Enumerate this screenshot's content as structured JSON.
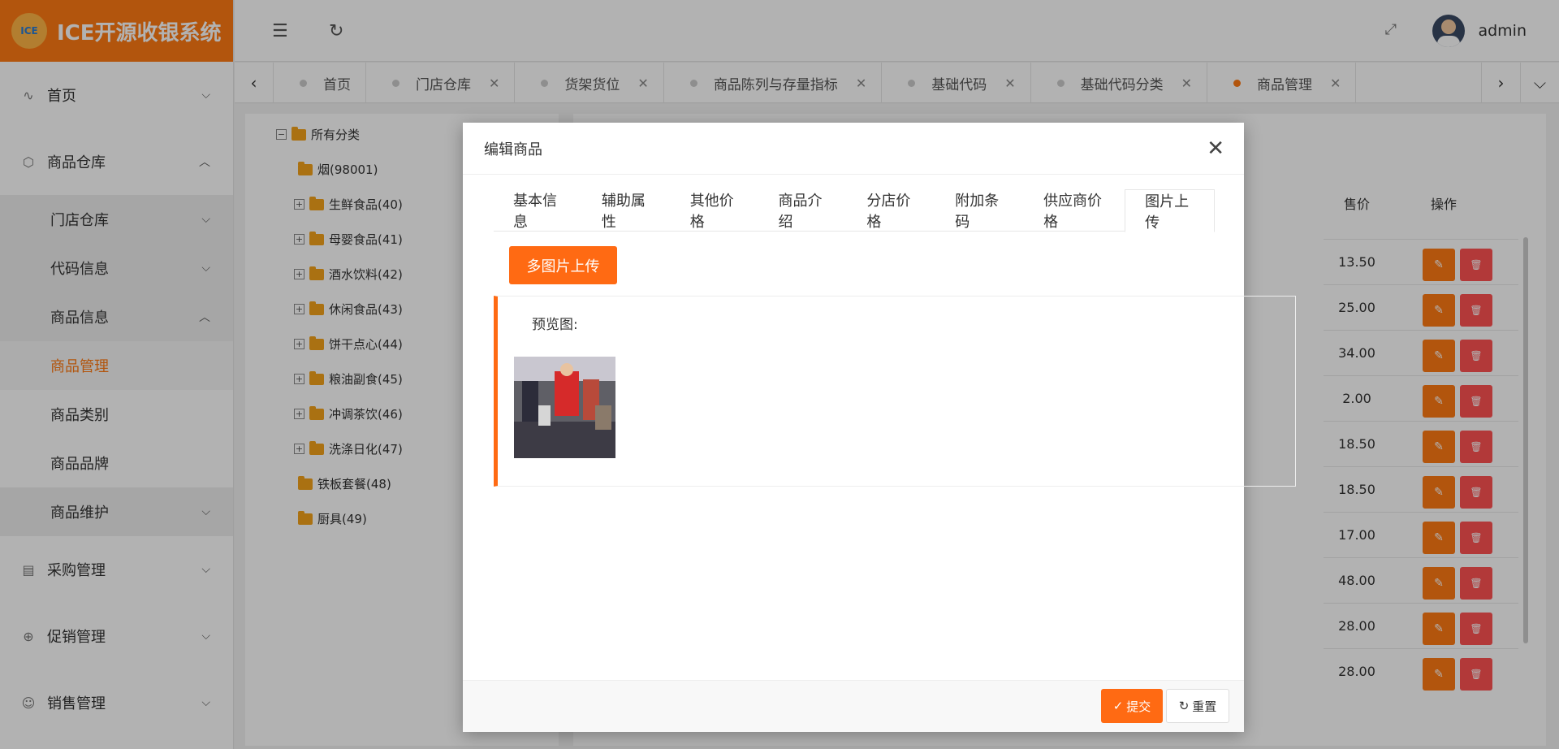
{
  "app": {
    "title": "ICE开源收银系统",
    "logo_text": "ICE"
  },
  "sidebar": {
    "items": [
      {
        "label": "首页",
        "icon": "pulse-icon"
      },
      {
        "label": "商品仓库",
        "icon": "cube-icon"
      },
      {
        "label": "采购管理",
        "icon": "doc-icon"
      },
      {
        "label": "促销管理",
        "icon": "download-circle-icon"
      },
      {
        "label": "销售管理",
        "icon": "users-icon"
      }
    ],
    "sub_items": [
      {
        "label": "门店仓库"
      },
      {
        "label": "代码信息"
      },
      {
        "label": "商品信息"
      }
    ],
    "sub_sub_items": [
      {
        "label": "商品管理"
      },
      {
        "label": "商品类别"
      },
      {
        "label": "商品品牌"
      }
    ],
    "sub_item_after": {
      "label": "商品维护"
    }
  },
  "header": {
    "user": "admin"
  },
  "tabs": [
    {
      "label": "首页"
    },
    {
      "label": "门店仓库"
    },
    {
      "label": "货架货位"
    },
    {
      "label": "商品陈列与存量指标"
    },
    {
      "label": "基础代码"
    },
    {
      "label": "基础代码分类"
    },
    {
      "label": "商品管理"
    }
  ],
  "tree": {
    "root": "所有分类",
    "nodes": [
      {
        "label": "烟(98001)"
      },
      {
        "label": "生鲜食品(40)"
      },
      {
        "label": "母婴食品(41)"
      },
      {
        "label": "酒水饮料(42)"
      },
      {
        "label": "休闲食品(43)"
      },
      {
        "label": "饼干点心(44)"
      },
      {
        "label": "粮油副食(45)"
      },
      {
        "label": "冲调茶饮(46)"
      },
      {
        "label": "洗涤日化(47)"
      },
      {
        "label": "铁板套餐(48)"
      },
      {
        "label": "厨具(49)"
      }
    ]
  },
  "grid": {
    "col_price": "售价",
    "col_op": "操作",
    "prices": [
      "13.50",
      "25.00",
      "34.00",
      "2.00",
      "18.50",
      "18.50",
      "17.00",
      "48.00",
      "28.00",
      "28.00"
    ]
  },
  "modal": {
    "title": "编辑商品",
    "tabs": [
      "基本信息",
      "辅助属性",
      "其他价格",
      "商品介绍",
      "分店价格",
      "附加条码",
      "供应商价格",
      "图片上传"
    ],
    "upload_button": "多图片上传",
    "preview_label": "预览图:",
    "submit": "提交",
    "reset": "重置"
  }
}
